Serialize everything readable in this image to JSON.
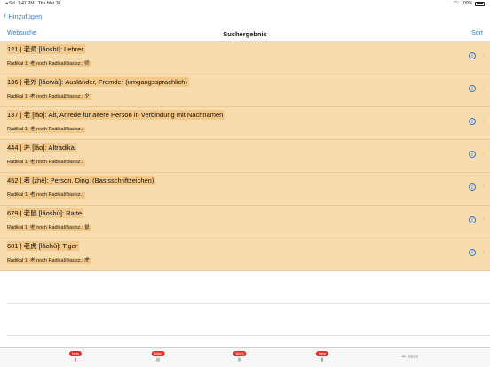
{
  "status_bar": {
    "carrier": "◂ Siri",
    "time": "1:47 PM",
    "date": "Thu Mar 30",
    "battery": "100%"
  },
  "back": {
    "label": "Hinzufügen"
  },
  "nav": {
    "left_label": "Websuche",
    "title": "Suchergebnis",
    "right_label": "Sort"
  },
  "results": [
    {
      "title": "121 | 老师 [lǎoshī]: Lehrer",
      "subtitle": "Radikal 1: 老   noch Radikal/Basisz.: 师"
    },
    {
      "title": "136 | 老外 [lǎowài]: Ausländer, Fremder (umgangssprachlich)",
      "subtitle": "Radikal 1: 老   noch Radikal/Basisz.: 夕"
    },
    {
      "title": "137 | 老 [lǎo]: Alt, Anrede für ältere Person in Verbindung mit Nachnamen",
      "subtitle": "Radikal 1: 老   noch Radikal/Basisz.:"
    },
    {
      "title": "444 | 耂 [lǎo]: Altradikal",
      "subtitle": "Radikal 1: 老   noch Radikal/Basisz.:"
    },
    {
      "title": "452 | 者 [zhě]: Person, Ding, (Basisschriftzeichen)",
      "subtitle": "Radikal 1: 老   noch Radikal/Basisz.:"
    },
    {
      "title": "679 | 老鼠 [lǎoshǔ]: Ratte",
      "subtitle": "Radikal 1: 老   noch Radikal/Basisz.: 鼠"
    },
    {
      "title": "681 | 老虎 [lǎohǔ]: Tiger",
      "subtitle": "Radikal 1: 老   noch Radikal/Basisz.: 虎"
    }
  ],
  "tabs": [
    {
      "badge": "New",
      "glyph": "▮"
    },
    {
      "badge": "Main",
      "glyph": "▦"
    },
    {
      "badge": "Work",
      "glyph": "▦"
    },
    {
      "badge": "Help",
      "glyph": "▮"
    }
  ],
  "more_tab": {
    "label": "More",
    "icon": "more-dots-icon"
  },
  "colors": {
    "row_bg": "#f8dcae",
    "text_highlight": "#f3c98b",
    "accent": "#2f7bd8",
    "badge": "#e0302b"
  }
}
